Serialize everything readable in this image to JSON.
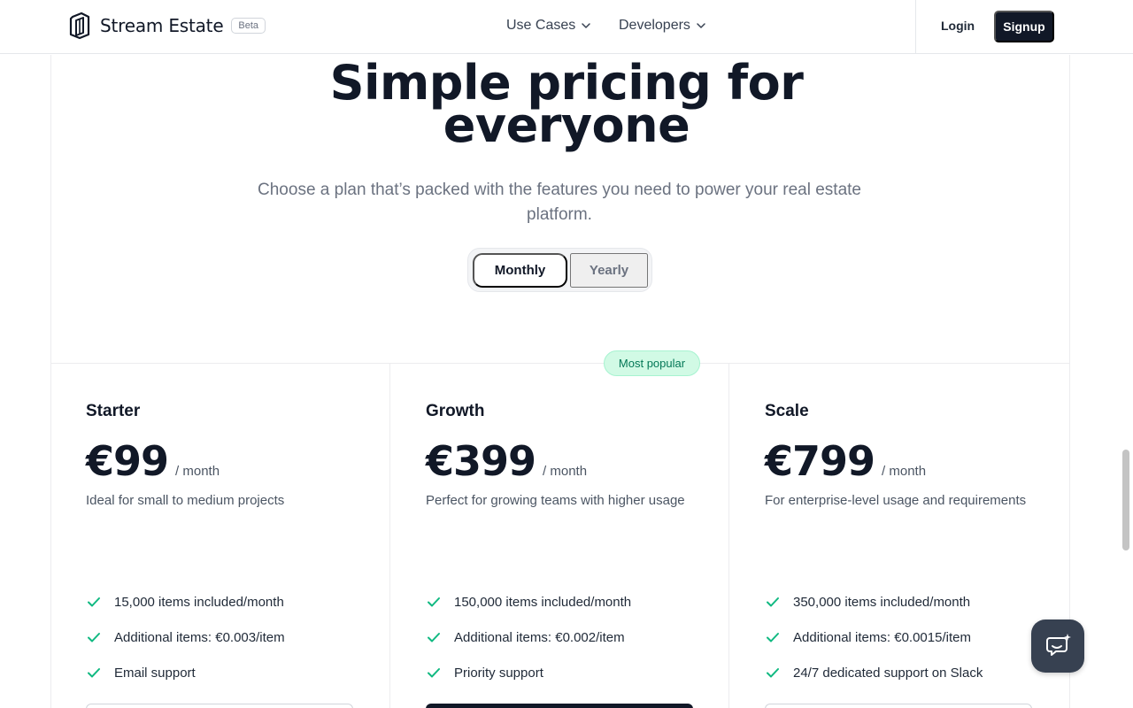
{
  "header": {
    "brand_name": "Stream Estate",
    "beta_badge": "Beta",
    "nav": [
      {
        "label": "Use Cases"
      },
      {
        "label": "Developers"
      }
    ],
    "login_label": "Login",
    "signup_label": "Signup"
  },
  "hero": {
    "title": "Simple pricing for everyone",
    "subtitle": "Choose a plan that’s packed with the features you need to power your real estate platform.",
    "billing_toggle": {
      "options": [
        "Monthly",
        "Yearly"
      ],
      "selected": "Monthly"
    }
  },
  "plans": [
    {
      "name": "Starter",
      "price": "€99",
      "period": "/ month",
      "description": "Ideal for small to medium projects",
      "features": [
        "15,000 items included/month",
        "Additional items: €0.003/item",
        "Email support"
      ]
    },
    {
      "name": "Growth",
      "badge": "Most popular",
      "price": "€399",
      "period": "/ month",
      "description": "Perfect for growing teams with higher usage",
      "features": [
        "150,000 items included/month",
        "Additional items: €0.002/item",
        "Priority support"
      ]
    },
    {
      "name": "Scale",
      "price": "€799",
      "period": "/ month",
      "description": "For enterprise-level usage and requirements",
      "features": [
        "350,000 items included/month",
        "Additional items: €0.0015/item",
        "24/7 dedicated support on Slack"
      ]
    }
  ],
  "colors": {
    "primary_dark": "#111827",
    "accent_green": "#10b981",
    "badge_bg": "#d1fae5",
    "chat_bg": "#374151"
  },
  "icons": {
    "logo": "stream-estate-logo-icon",
    "chevron": "chevron-down-icon",
    "check": "check-icon",
    "chat": "chat-support-icon"
  }
}
